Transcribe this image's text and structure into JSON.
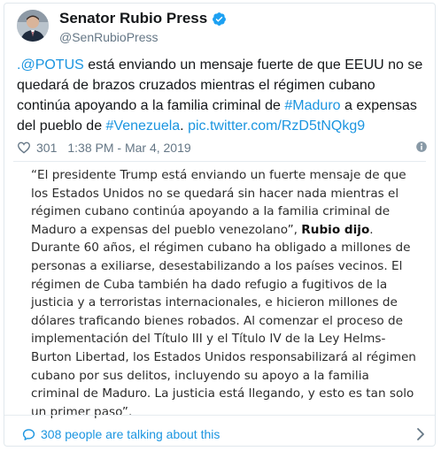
{
  "header": {
    "display_name": "Senator Rubio Press",
    "handle": "@SenRubioPress",
    "verified_icon": "verified-badge-icon"
  },
  "tweet": {
    "segments": [
      {
        "text": ".@POTUS",
        "link": true
      },
      {
        "text": " está enviando un mensaje fuerte de que EEUU no se quedará de brazos cruzados mientras el régimen cubano continúa apoyando a la familia criminal de ",
        "link": false
      },
      {
        "text": "#Maduro",
        "link": true
      },
      {
        "text": " a expensas del pueblo de ",
        "link": false
      },
      {
        "text": "#Venezuela",
        "link": true
      },
      {
        "text": ". ",
        "link": false
      },
      {
        "text": "pic.twitter.com/RzD5tNQkg9",
        "link": true
      }
    ]
  },
  "meta": {
    "likes": "301",
    "timestamp": "1:38 PM - Mar 4, 2019",
    "heart_icon": "heart-icon",
    "info_icon": "info-icon"
  },
  "quote": {
    "before_bold": "“El presidente Trump está enviando un fuerte mensaje de que los Estados Unidos no se quedará sin hacer nada mientras el régimen cubano continúa apoyando a la familia criminal de Maduro a expensas del pueblo venezolano”, ",
    "bold": "Rubio dijo",
    "after_bold": ". Durante 60 años, el régimen cubano ha obligado a millones de personas a exiliarse, desestabilizando a los países vecinos. El régimen de Cuba también ha dado refugio a fugitivos de la justicia y a terroristas internacionales, e hicieron millones de dólares traficando bienes robados. Al comenzar el proceso de implementación del Título III y el Título IV de la Ley Helms-Burton Libertad, los Estados Unidos responsabilizará al régimen cubano por sus delitos, incluyendo su apoyo a la familia criminal de Maduro. La justicia está llegando, y esto es tan solo un primer paso”."
  },
  "footer": {
    "talking_label": "308 people are talking about this",
    "bubble_icon": "comment-bubble-icon",
    "chevron_icon": "chevron-right-icon"
  },
  "colors": {
    "link": "#1b95e0",
    "secondary": "#657786",
    "verified": "#1da1f2",
    "border": "#e1e8ed"
  }
}
